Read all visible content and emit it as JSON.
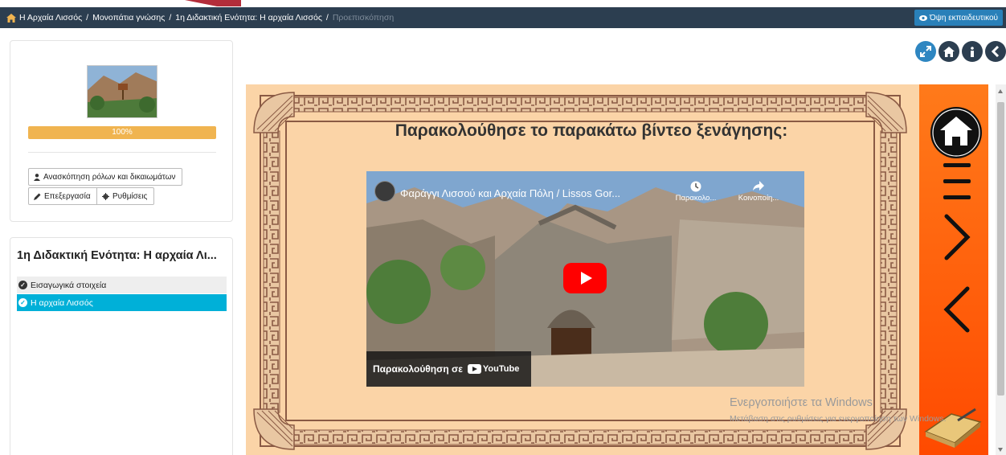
{
  "breadcrumb": {
    "items": [
      "Η Αρχαία Λισσός",
      "Μονοπάτια γνώσης",
      "1η Διδακτική Ενότητα: Η αρχαία Λισσός"
    ],
    "current": "Προεπισκόπηση"
  },
  "header": {
    "teacher_view_label": "Όψη εκπαιδευτικού"
  },
  "round_buttons": [
    "expand-icon",
    "home-icon",
    "info-icon",
    "back-icon"
  ],
  "course_card": {
    "progress": "100%",
    "progress_value": 1.0,
    "review_roles_label": "Ανασκόπηση ρόλων και δικαιωμάτων",
    "edit_label": "Επεξεργασία",
    "settings_label": "Ρυθμίσεις"
  },
  "unit": {
    "title": "1η Διδακτική Ενότητα: Η αρχαία Λι...",
    "items": [
      {
        "label": "Εισαγωγικά στοιχεία",
        "active": false
      },
      {
        "label": "Η αρχαία Λισσός",
        "active": true
      }
    ]
  },
  "slide": {
    "heading": "Παρακολούθησε το παρακάτω βίντεο ξενάγησης:",
    "video": {
      "title": "Φαράγγι Λισσού και Αρχαία Πόλη / Lissos Gor...",
      "watch_later": "Παρακολο...",
      "share": "Κοινοποίη...",
      "watch_on": "Παρακολούθηση σε",
      "platform": "YouTube"
    }
  },
  "watermark": {
    "line1": "Ενεργοποιήστε τα Windows",
    "line2": "Μετάβαση στις ρυθμίσεις για ενεργοποίηση των Windows."
  },
  "colors": {
    "breadcrumb_bg": "#2c3e50",
    "accent_red": "#b32d3a",
    "active_item": "#00b0d8",
    "progress": "#f0b450",
    "nav_orange": "#ff5a00"
  }
}
